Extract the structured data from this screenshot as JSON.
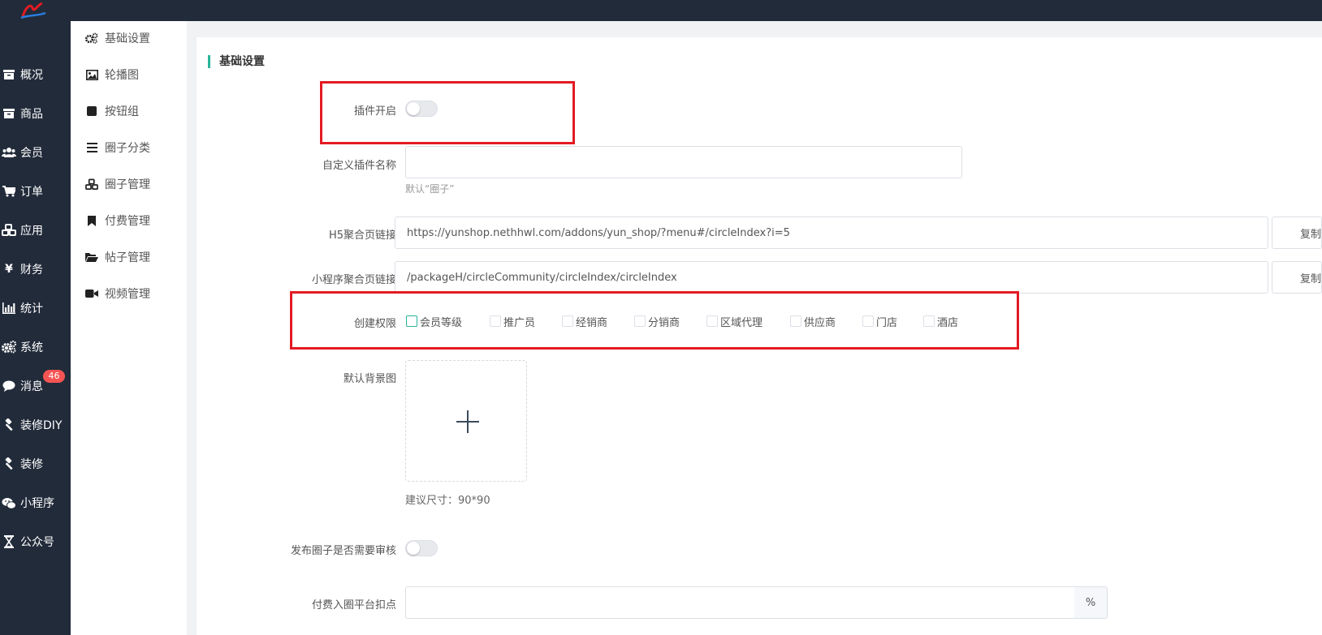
{
  "nav": {
    "items": [
      {
        "label": "概况",
        "icon": "archive-icon"
      },
      {
        "label": "商品",
        "icon": "archive-icon"
      },
      {
        "label": "会员",
        "icon": "users-icon"
      },
      {
        "label": "订单",
        "icon": "cart-icon"
      },
      {
        "label": "应用",
        "icon": "cubes-icon"
      },
      {
        "label": "财务",
        "icon": "yen-icon"
      },
      {
        "label": "统计",
        "icon": "bar-chart-icon"
      },
      {
        "label": "系统",
        "icon": "gears-icon"
      },
      {
        "label": "消息",
        "icon": "comment-icon"
      },
      {
        "label": "装修DIY",
        "icon": "gavel-icon"
      },
      {
        "label": "装修",
        "icon": "gavel-icon"
      },
      {
        "label": "小程序",
        "icon": "wechat-icon"
      },
      {
        "label": "公众号",
        "icon": "hourglass-icon"
      }
    ],
    "message_badge": "46"
  },
  "subnav": {
    "items": [
      {
        "label": "基础设置",
        "icon": "gears-icon"
      },
      {
        "label": "轮播图",
        "icon": "image-icon"
      },
      {
        "label": "按钮组",
        "icon": "square-icon"
      },
      {
        "label": "圈子分类",
        "icon": "list-icon"
      },
      {
        "label": "圈子管理",
        "icon": "cubes-icon"
      },
      {
        "label": "付费管理",
        "icon": "bookmark-icon"
      },
      {
        "label": "帖子管理",
        "icon": "folder-open-icon"
      },
      {
        "label": "视频管理",
        "icon": "video-camera-icon"
      }
    ]
  },
  "form": {
    "section_title": "基础设置",
    "plugin_enable_label": "插件开启",
    "plugin_enabled": false,
    "custom_name_label": "自定义插件名称",
    "custom_name_value": "",
    "custom_name_hint": "默认“圈子”",
    "h5_link_label": "H5聚合页链接",
    "h5_link_value": "https://yunshop.nethhwl.com/addons/yun_shop/?menu#/circleIndex?i=5",
    "copy_label": "复制",
    "mini_link_label": "小程序聚合页链接",
    "mini_link_value": "/packageH/circleCommunity/circleIndex/circleIndex",
    "permission_label": "创建权限",
    "permissions": [
      "会员等级",
      "推广员",
      "经销商",
      "分销商",
      "区域代理",
      "供应商",
      "门店",
      "酒店"
    ],
    "bg_label": "默认背景图",
    "bg_hint": "建议尺寸：90*90",
    "review_label": "发布圈子是否需要审核",
    "review_enabled": false,
    "fee_label": "付费入圈平台扣点",
    "fee_value": "",
    "fee_unit": "%"
  },
  "colors": {
    "sidebar": "#222b3a",
    "accent": "#29b49a",
    "badge": "#f55454",
    "highlight_box": "#e31b23"
  }
}
